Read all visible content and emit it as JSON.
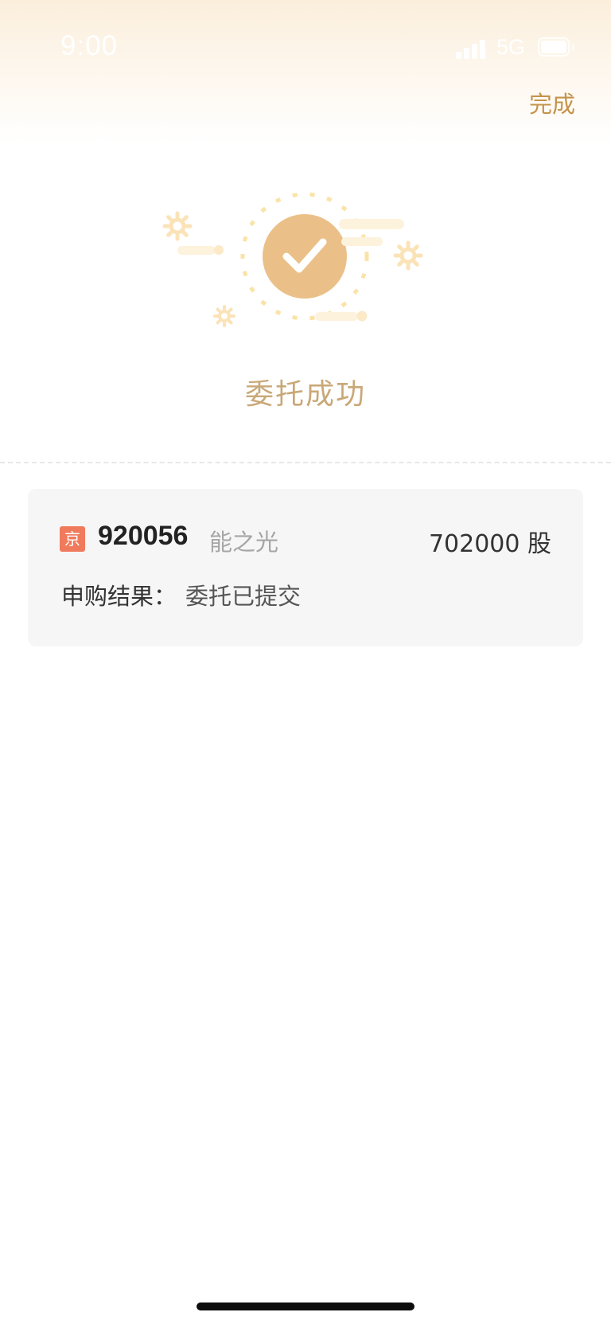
{
  "status_bar": {
    "time": "9:00",
    "network": "5G"
  },
  "header": {
    "done_label": "完成"
  },
  "result": {
    "title": "委托成功",
    "icon": "checkmark-circle-icon"
  },
  "order_card": {
    "market_badge": "京",
    "stock_code": "920056",
    "stock_name": "能之光",
    "quantity": "702000 股",
    "result_label": "申购结果：",
    "result_value": "委托已提交"
  },
  "colors": {
    "accent": "#c4934b",
    "check_circle": "#ebc088",
    "badge": "#f07a5c",
    "card_bg": "#f6f6f6"
  }
}
